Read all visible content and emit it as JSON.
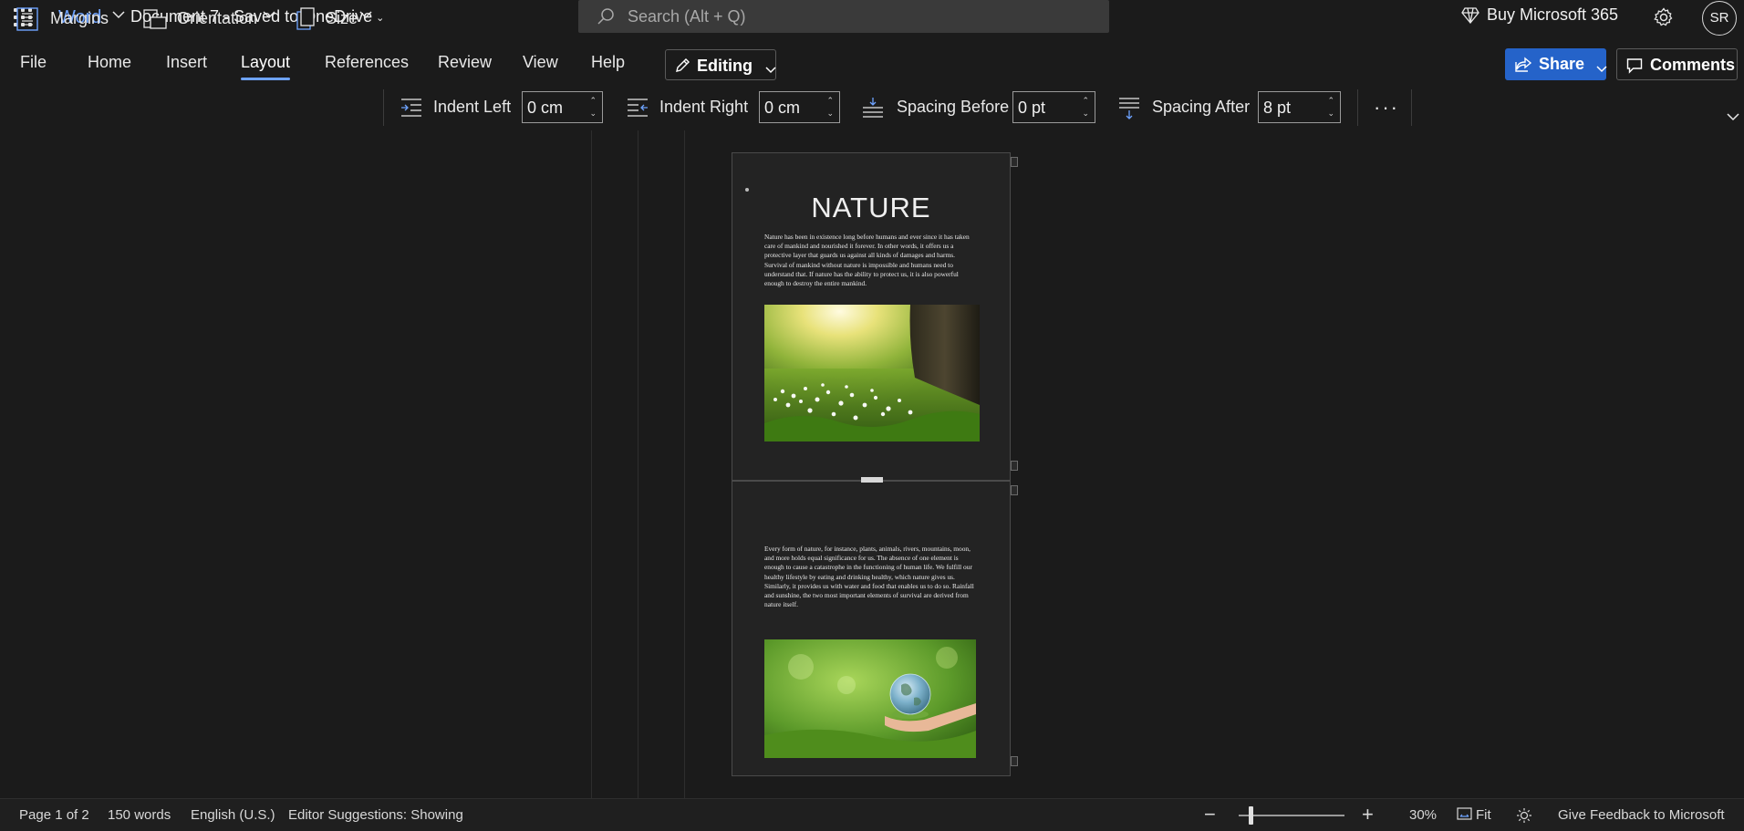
{
  "app": {
    "name": "Word",
    "doc_title": "Document 7 - Saved to OneDrive"
  },
  "search": {
    "placeholder": "Search (Alt + Q)"
  },
  "header": {
    "buy": "Buy Microsoft 365",
    "avatar": "SR"
  },
  "tabs": [
    {
      "label": "File"
    },
    {
      "label": "Home"
    },
    {
      "label": "Insert"
    },
    {
      "label": "Layout",
      "active": true
    },
    {
      "label": "References"
    },
    {
      "label": "Review"
    },
    {
      "label": "View"
    },
    {
      "label": "Help"
    }
  ],
  "editing_label": "Editing",
  "share_label": "Share",
  "comments_label": "Comments",
  "commands": {
    "margins": "Margins",
    "orientation": "Orientation",
    "size": "Size",
    "indent_left": {
      "label": "Indent Left",
      "value": "0 cm"
    },
    "indent_right": {
      "label": "Indent Right",
      "value": "0 cm"
    },
    "spacing_before": {
      "label": "Spacing Before",
      "value": "0 pt"
    },
    "spacing_after": {
      "label": "Spacing After",
      "value": "8 pt"
    },
    "more": "···"
  },
  "document": {
    "title": "NATURE",
    "paragraph1": "Nature has been in existence long before humans and ever since it has taken care of mankind and nourished it forever. In other words, it offers us a protective layer that guards us against all kinds of damages and harms. Survival of mankind without nature is impossible and humans need to understand that. If nature has the ability to protect us, it is also powerful enough to destroy the entire mankind.",
    "paragraph2": "Every form of nature, for instance, plants, animals, rivers, mountains, moon, and more holds equal significance for us. The absence of one element is enough to cause a catastrophe in the functioning of human life. We fulfill our healthy lifestyle by eating and drinking healthy, which nature gives us. Similarly, it provides us with water and food that enables us to do so. Rainfall and sunshine, the two most important elements of survival are derived from nature itself."
  },
  "status": {
    "page": "Page 1 of 2",
    "words": "150 words",
    "language": "English (U.S.)",
    "editor": "Editor Suggestions: Showing",
    "zoom": "30%",
    "zoom_level": 0.3,
    "fit": "Fit",
    "feedback": "Give Feedback to Microsoft"
  }
}
